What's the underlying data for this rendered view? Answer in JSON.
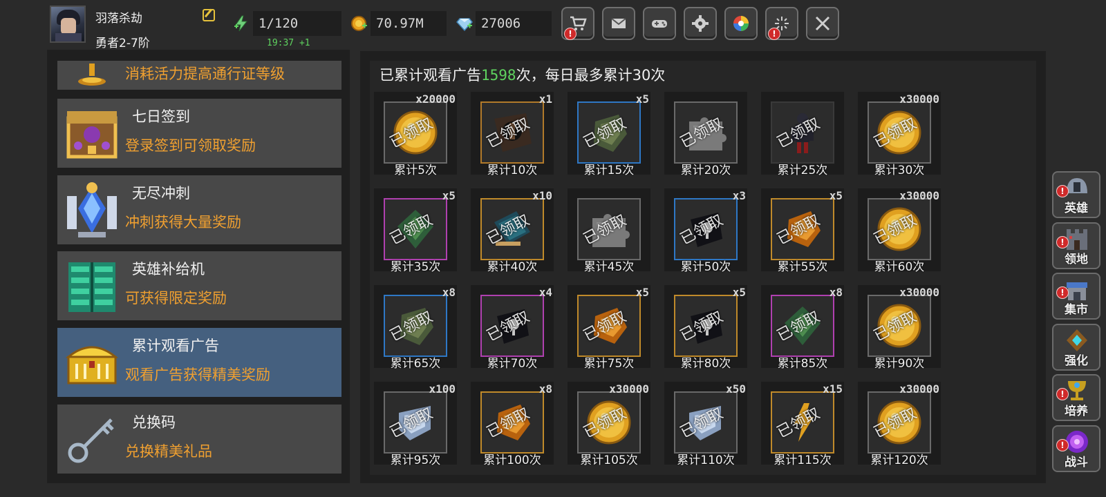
{
  "player": {
    "name": "羽落杀劫",
    "rank": "勇者2-7阶"
  },
  "resources": {
    "energy": "1/120",
    "energy_timer": "19:37 +1",
    "gold": "70.97M",
    "gems": "27006"
  },
  "toolbar": [
    {
      "icon": "shop-cart-icon",
      "alert": true
    },
    {
      "icon": "mail-icon",
      "alert": false
    },
    {
      "icon": "gamepad-icon",
      "alert": false
    },
    {
      "icon": "settings-gear-icon",
      "alert": false
    },
    {
      "icon": "color-wheel-icon",
      "alert": false
    },
    {
      "icon": "fireworks-icon",
      "alert": true
    },
    {
      "icon": "crossed-swords-icon",
      "alert": false
    }
  ],
  "alert_mark": "!",
  "menu": [
    {
      "title": "",
      "desc": "消耗活力提高通行证等级",
      "icon": "trophy-icon",
      "active": false
    },
    {
      "title": "七日签到",
      "desc": "登录签到可领取奖励",
      "icon": "treasure-chest-icon",
      "active": false
    },
    {
      "title": "无尽冲刺",
      "desc": "冲刺获得大量奖励",
      "icon": "crystal-trophy-icon",
      "active": false
    },
    {
      "title": "英雄补给机",
      "desc": "可获得限定奖励",
      "icon": "supply-machine-icon",
      "active": false
    },
    {
      "title": "累计观看广告",
      "desc": "观看广告获得精美奖励",
      "icon": "gold-chest-icon",
      "active": true
    },
    {
      "title": "兑换码",
      "desc": "兑换精美礼品",
      "icon": "key-icon",
      "active": false
    }
  ],
  "ad_header": {
    "prefix": "已累计观看广告",
    "count": "1598",
    "suffix": "次，每日最多累计30次"
  },
  "claimed_label": "已领取",
  "rewards": [
    {
      "qty": "x20000",
      "label": "累计5次",
      "item": "gold-coin",
      "frame": "#6a6a6a"
    },
    {
      "qty": "x1",
      "label": "累计10次",
      "item": "hero-shard",
      "frame": "#b27a2a"
    },
    {
      "qty": "x5",
      "label": "累计15次",
      "item": "armor-stone",
      "frame": "#2e78c6"
    },
    {
      "qty": "",
      "label": "累计20次",
      "item": "puzzle-piece",
      "frame": "#6a6a6a"
    },
    {
      "qty": "",
      "label": "累计25次",
      "item": "dark-knight",
      "frame": "#3a3a3a"
    },
    {
      "qty": "x30000",
      "label": "累计30次",
      "item": "gold-coin",
      "frame": "#6a6a6a"
    },
    {
      "qty": "x5",
      "label": "累计35次",
      "item": "green-rune",
      "frame": "#b040b0"
    },
    {
      "qty": "x10",
      "label": "累计40次",
      "item": "skill-book",
      "frame": "#c08a2a"
    },
    {
      "qty": "",
      "label": "累计45次",
      "item": "puzzle-piece",
      "frame": "#6a6a6a"
    },
    {
      "qty": "x3",
      "label": "累计50次",
      "item": "dark-shard",
      "frame": "#2e78c6"
    },
    {
      "qty": "x5",
      "label": "累计55次",
      "item": "amber-stone",
      "frame": "#c08a2a"
    },
    {
      "qty": "x30000",
      "label": "累计60次",
      "item": "gold-coin",
      "frame": "#6a6a6a"
    },
    {
      "qty": "x8",
      "label": "累计65次",
      "item": "armor-stone",
      "frame": "#2e78c6"
    },
    {
      "qty": "x4",
      "label": "累计70次",
      "item": "dark-shard",
      "frame": "#b040b0"
    },
    {
      "qty": "x5",
      "label": "累计75次",
      "item": "amber-stone",
      "frame": "#c08a2a"
    },
    {
      "qty": "x5",
      "label": "累计80次",
      "item": "dark-shard",
      "frame": "#c08a2a"
    },
    {
      "qty": "x8",
      "label": "累计85次",
      "item": "green-rune",
      "frame": "#b040b0"
    },
    {
      "qty": "x30000",
      "label": "累计90次",
      "item": "gold-coin",
      "frame": "#6a6a6a"
    },
    {
      "qty": "x100",
      "label": "累计95次",
      "item": "silver-shard",
      "frame": "#6a6a6a"
    },
    {
      "qty": "x8",
      "label": "累计100次",
      "item": "amber-stone",
      "frame": "#c08a2a"
    },
    {
      "qty": "x30000",
      "label": "累计105次",
      "item": "gold-coin",
      "frame": "#6a6a6a"
    },
    {
      "qty": "x50",
      "label": "累计110次",
      "item": "silver-shard",
      "frame": "#6a6a6a"
    },
    {
      "qty": "x15",
      "label": "累计115次",
      "item": "lightning-shard",
      "frame": "#c08a2a"
    },
    {
      "qty": "x30000",
      "label": "累计120次",
      "item": "gold-coin",
      "frame": "#6a6a6a"
    }
  ],
  "side_nav": [
    {
      "label": "英雄",
      "icon": "helmet-icon",
      "alert": true
    },
    {
      "label": "领地",
      "icon": "castle-icon",
      "alert": true
    },
    {
      "label": "集市",
      "icon": "market-icon",
      "alert": true
    },
    {
      "label": "强化",
      "icon": "upgrade-gem-icon",
      "alert": false
    },
    {
      "label": "培养",
      "icon": "goblet-icon",
      "alert": true
    },
    {
      "label": "战斗",
      "icon": "portal-icon",
      "alert": true
    }
  ],
  "colors": {
    "accent_orange": "#f0a030",
    "green_text": "#5fd35f",
    "active_menu": "#45607f",
    "alert_red": "#d02a2a"
  }
}
